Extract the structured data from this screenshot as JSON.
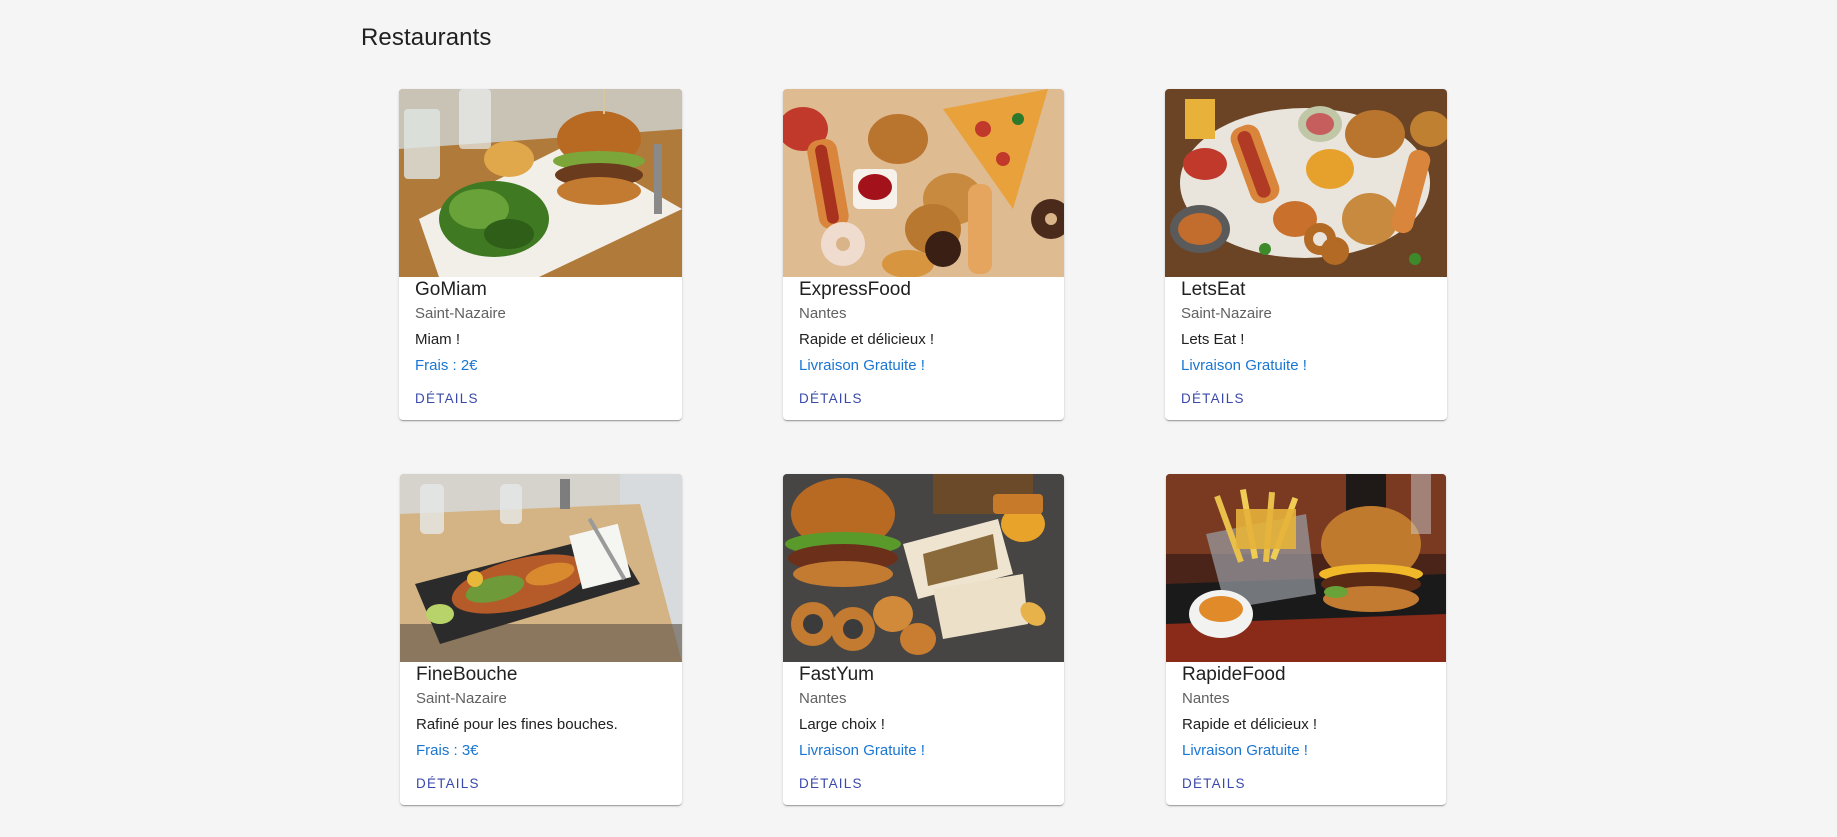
{
  "page": {
    "title": "Restaurants"
  },
  "colors": {
    "accent_fee": "#1976d2",
    "button": "#3949ab",
    "background": "#f5f5f5"
  },
  "restaurants": [
    {
      "name": "GoMiam",
      "city": "Saint-Nazaire",
      "description": "Miam !",
      "fee": "Frais : 2€",
      "button": "Détails",
      "image": "burger-salad-plate"
    },
    {
      "name": "ExpressFood",
      "city": "Nantes",
      "description": "Rapide et délicieux !",
      "fee": "Livraison Gratuite !",
      "button": "Détails",
      "image": "fast-food-spread"
    },
    {
      "name": "LetsEat",
      "city": "Saint-Nazaire",
      "description": "Lets Eat !",
      "fee": "Livraison Gratuite !",
      "button": "Détails",
      "image": "fast-food-table"
    },
    {
      "name": "FineBouche",
      "city": "Saint-Nazaire",
      "description": "Rafiné pour les fines bouches.",
      "fee": "Frais : 3€",
      "button": "Détails",
      "image": "fine-dining-plate"
    },
    {
      "name": "FastYum",
      "city": "Nantes",
      "description": "Large choix !",
      "fee": "Livraison Gratuite !",
      "button": "Détails",
      "image": "burger-wraps-nuggets"
    },
    {
      "name": "RapideFood",
      "city": "Nantes",
      "description": "Rapide et délicieux !",
      "fee": "Livraison Gratuite !",
      "button": "Détails",
      "image": "burger-fries-tray"
    }
  ]
}
